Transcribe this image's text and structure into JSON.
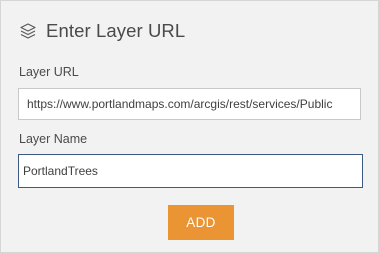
{
  "header": {
    "icon": "layers-icon",
    "title": "Enter Layer URL"
  },
  "layer_url": {
    "label": "Layer URL",
    "value": "https://www.portlandmaps.com/arcgis/rest/services/Public"
  },
  "layer_name": {
    "label": "Layer Name",
    "value": "PortlandTrees"
  },
  "add_button": {
    "label": "ADD",
    "color": "#ea9433"
  }
}
